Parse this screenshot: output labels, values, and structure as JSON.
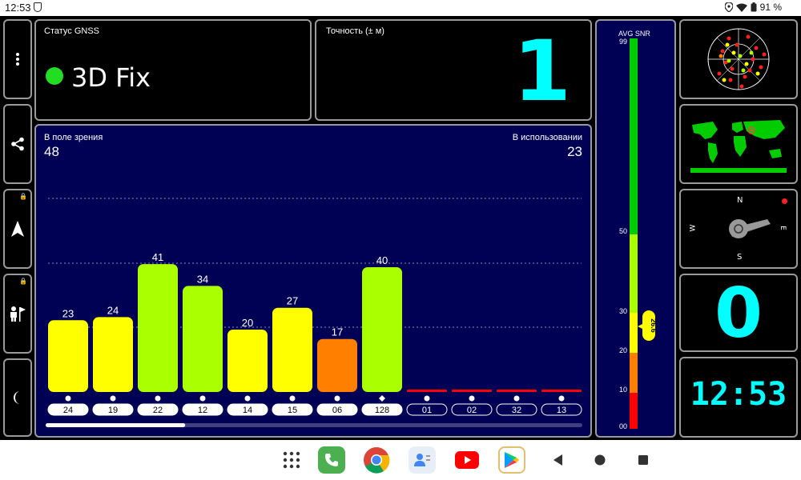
{
  "status_bar": {
    "time": "12:53",
    "battery": "91 %"
  },
  "gnss_status": {
    "title": "Статус GNSS",
    "value": "3D Fix",
    "indicator_color": "#22dd22"
  },
  "accuracy": {
    "title": "Точность (± м)",
    "value": "1"
  },
  "satellites": {
    "in_view_label": "В поле зрения",
    "in_view": "48",
    "in_use_label": "В использовании",
    "in_use": "23",
    "bars": [
      {
        "id": "24",
        "snr": 23,
        "color": "#ffff00",
        "marker": "dot"
      },
      {
        "id": "19",
        "snr": 24,
        "color": "#ffff00",
        "marker": "dot"
      },
      {
        "id": "22",
        "snr": 41,
        "color": "#aaff00",
        "marker": "dot"
      },
      {
        "id": "12",
        "snr": 34,
        "color": "#aaff00",
        "marker": "dot"
      },
      {
        "id": "14",
        "snr": 20,
        "color": "#ffff00",
        "marker": "dot"
      },
      {
        "id": "15",
        "snr": 27,
        "color": "#ffff00",
        "marker": "dot"
      },
      {
        "id": "06",
        "snr": 17,
        "color": "#ff8000",
        "marker": "dot"
      },
      {
        "id": "128",
        "snr": 40,
        "color": "#aaff00",
        "marker": "diamond"
      },
      {
        "id": "01",
        "snr": 0,
        "color": "#ff0000",
        "marker": "dot"
      },
      {
        "id": "02",
        "snr": 0,
        "color": "#ff0000",
        "marker": "dot"
      },
      {
        "id": "32",
        "snr": 0,
        "color": "#ff0000",
        "marker": "dot"
      },
      {
        "id": "13",
        "snr": 0,
        "color": "#ff0000",
        "marker": "dot"
      }
    ],
    "scroll_fraction": 0.26
  },
  "avg_snr": {
    "title": "AVG SNR",
    "value": "26.6",
    "ticks": [
      "99",
      "50",
      "30",
      "20",
      "10",
      "00"
    ],
    "colors": {
      "red": "#ff0000",
      "orange": "#ff8000",
      "yellow": "#ffff00",
      "lime": "#aaff00",
      "green": "#00cc00"
    }
  },
  "compass": {
    "n": "N",
    "s": "S",
    "e": "E",
    "w": "W"
  },
  "satellites_used_big": "0",
  "clock": "12:53",
  "taskbar": {
    "apps": [
      "apps-grid",
      "phone",
      "chrome",
      "contacts",
      "youtube",
      "play-store"
    ]
  }
}
